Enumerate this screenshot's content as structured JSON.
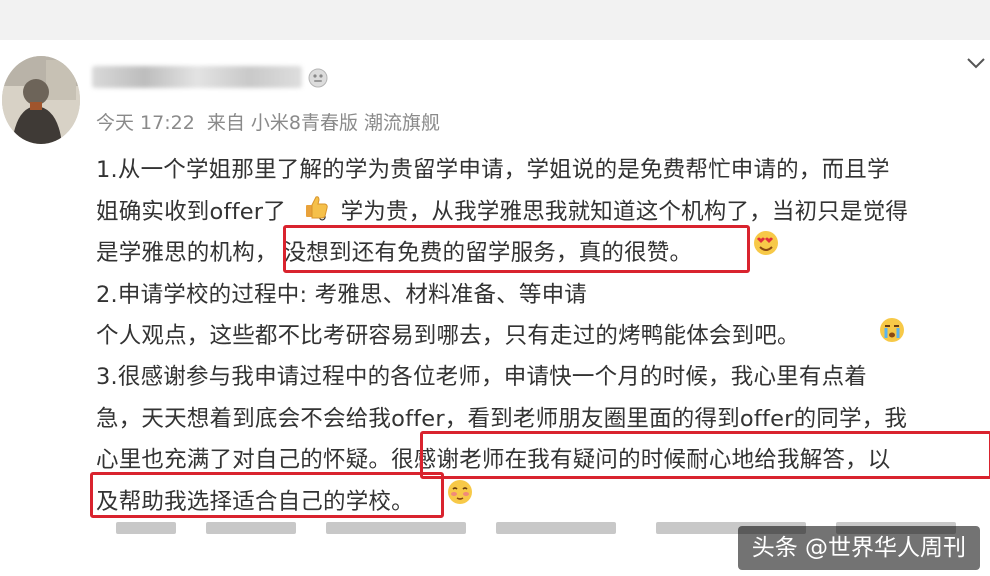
{
  "post": {
    "meta": {
      "time": "今天 17:22",
      "source": "来自 小米8青春版 潮流旗舰"
    },
    "lines": [
      "1.从一个学姐那里了解的学为贵留学申请，学姐说的是免费帮忙申请的，而且学",
      "姐确实收到offer了",
      "。学为贵，从我学雅思我就知道这个机构了，当初只是觉得",
      "是学雅思的机构，",
      "没想到还有免费的留学服务，真的很赞。",
      "2.申请学校的过程中: 考雅思、材料准备、等申请",
      "个人观点，这些都不比考研容易到哪去，只有走过的烤鸭能体会到吧。",
      "3.很感谢参与我申请过程中的各位老师，申请快一个月的时候，我心里有点着",
      "急，天天想着到底会不会给我offer，看到老师朋友圈里面的得到offer的同学，我",
      "心里也充满了对自己的怀疑。",
      "很感谢老师在我有疑问的时候耐心地给我解答，以",
      "及帮助我选择适合自己的学校。"
    ]
  },
  "icons": {
    "vip": "vip-badge-icon",
    "chevron": "chevron-down-icon",
    "thumbs_up": "thumbs-up-emoji-icon",
    "love": "heart-eyes-emoji-icon",
    "cry": "crying-emoji-icon",
    "shy": "shy-emoji-icon"
  },
  "watermark": {
    "text": "头条 @世界华人周刊"
  },
  "colors": {
    "highlight": "#d9232e",
    "text": "#333333",
    "meta": "#8a8a8a"
  }
}
